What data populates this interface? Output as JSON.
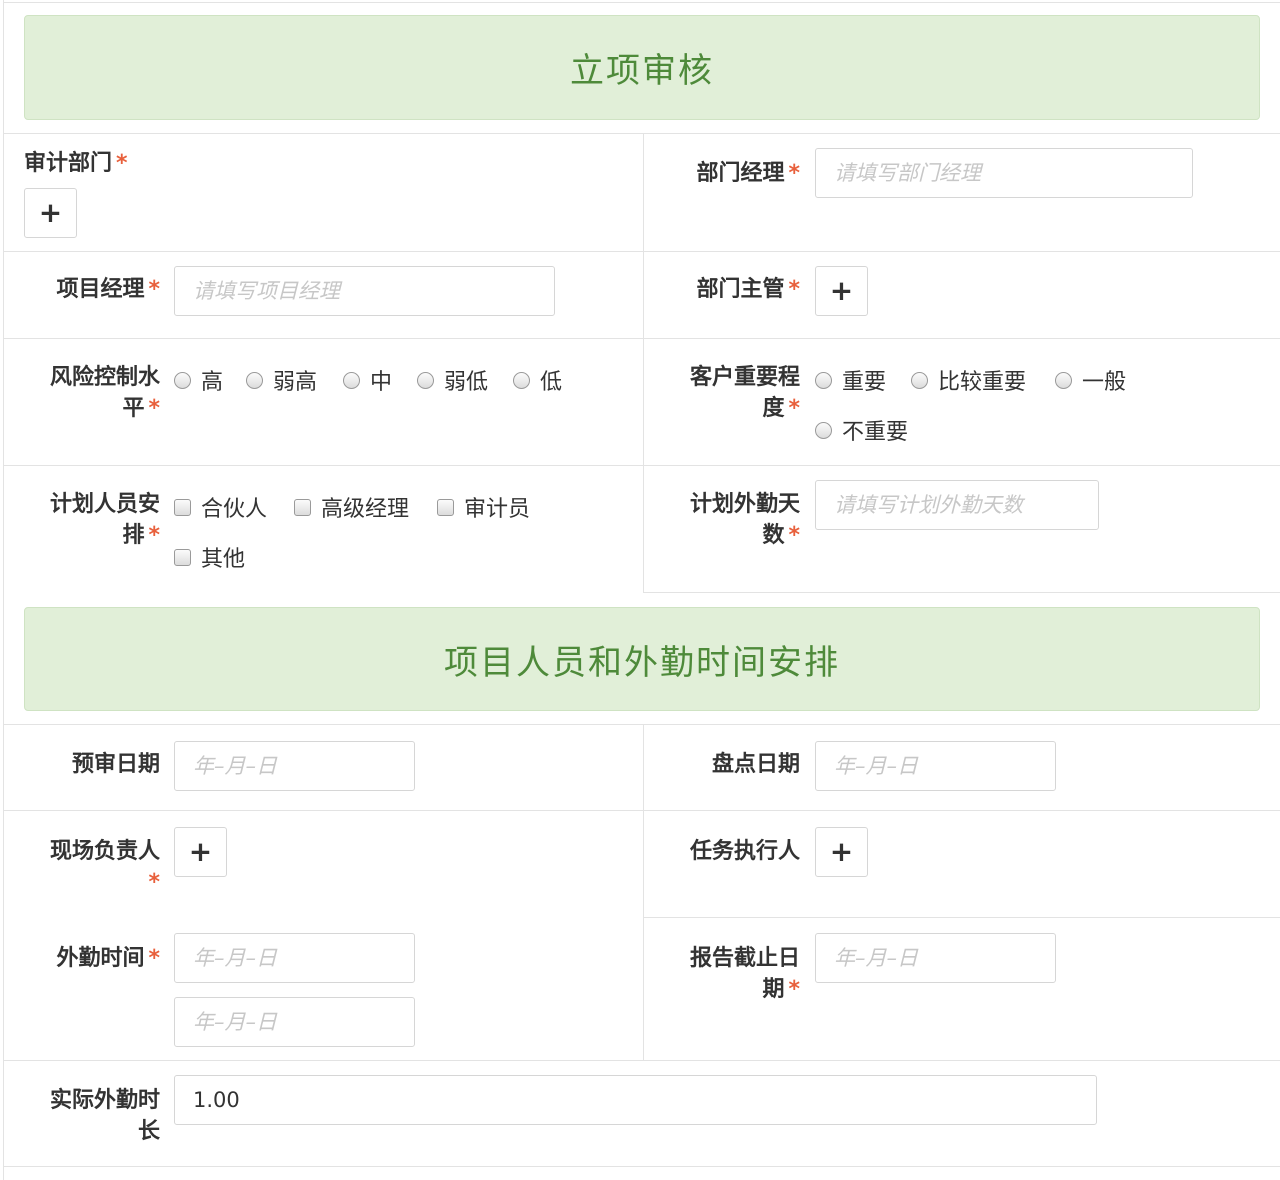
{
  "section1": {
    "title": "立项审核"
  },
  "section2": {
    "title": "项目人员和外勤时间安排"
  },
  "required_mark": "*",
  "plus_symbol": "+",
  "audit_dept": {
    "label": "审计部门"
  },
  "dept_manager": {
    "label": "部门经理",
    "placeholder": "请填写部门经理"
  },
  "project_manager": {
    "label": "项目经理",
    "placeholder": "请填写项目经理"
  },
  "dept_supervisor": {
    "label": "部门主管"
  },
  "risk_control": {
    "label_line1": "风险控制水",
    "label_line2": "平",
    "options": [
      "高",
      "弱高",
      "中",
      "弱低",
      "低"
    ]
  },
  "client_importance": {
    "label_line1": "客户重要程",
    "label_line2": "度",
    "options": [
      "重要",
      "比较重要",
      "一般",
      "不重要"
    ]
  },
  "planned_staff": {
    "label_line1": "计划人员安",
    "label_line2": "排",
    "options": [
      "合伙人",
      "高级经理",
      "审计员",
      "其他"
    ]
  },
  "planned_field_days": {
    "label_line1": "计划外勤天",
    "label_line2": "数",
    "placeholder": "请填写计划外勤天数"
  },
  "pre_audit_date": {
    "label": "预审日期",
    "placeholder": "年–月–日"
  },
  "inventory_date": {
    "label": "盘点日期",
    "placeholder": "年–月–日"
  },
  "site_lead": {
    "label": "现场负责人"
  },
  "task_executor": {
    "label": "任务执行人"
  },
  "field_time": {
    "label": "外勤时间",
    "placeholder_start": "年–月–日",
    "placeholder_end": "年–月–日"
  },
  "report_deadline": {
    "label_line1": "报告截止日",
    "label_line2": "期",
    "placeholder": "年–月–日"
  },
  "actual_field_duration": {
    "label_line1": "实际外勤时",
    "label_line2": "长",
    "value": "1.00"
  }
}
